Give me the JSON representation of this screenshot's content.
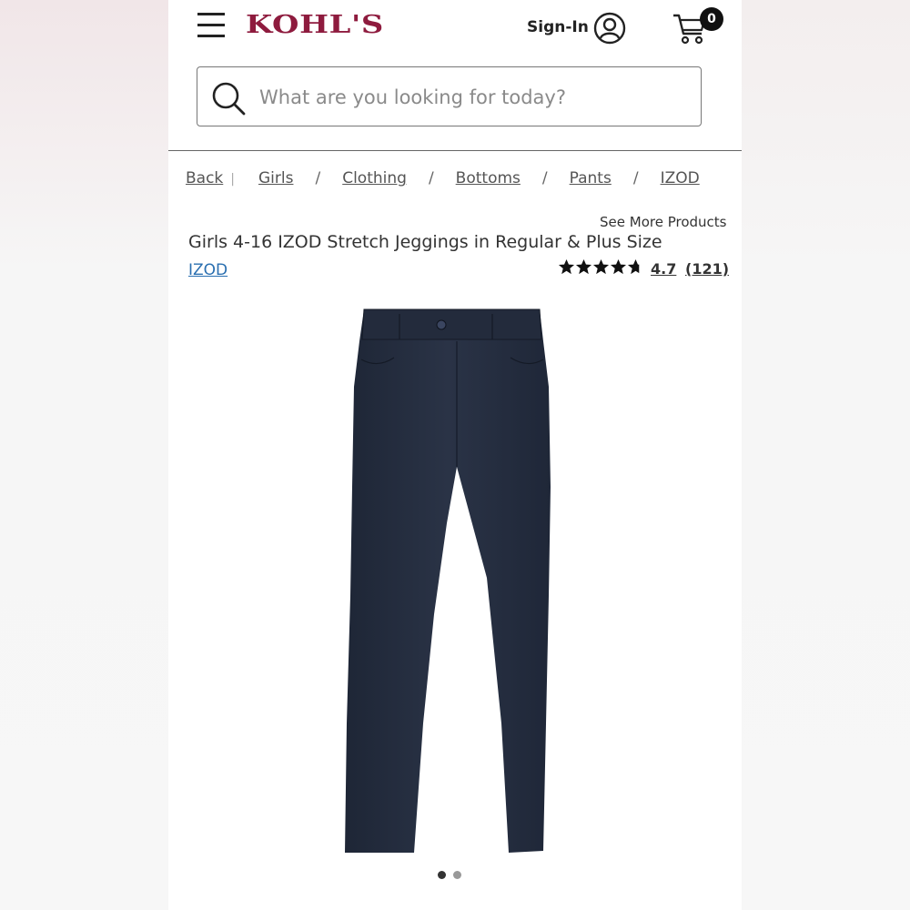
{
  "header": {
    "logo": "KOHL'S",
    "sign_in": "Sign-In",
    "cart_count": "0",
    "brand_color": "#8e1b3e"
  },
  "search": {
    "placeholder": "What are you looking for today?"
  },
  "breadcrumb": {
    "back": "Back",
    "items": [
      "Girls",
      "Clothing",
      "Bottoms",
      "Pants",
      "IZOD"
    ],
    "separator": "/"
  },
  "product": {
    "see_more": "See More Products",
    "title": "Girls 4-16 IZOD Stretch Jeggings in Regular & Plus Size",
    "brand": "IZOD",
    "rating": "4.7",
    "reviews": "(121)",
    "image_icon": "navy-jeggings-image",
    "link_color": "#2a6fb0"
  },
  "carousel": {
    "dots": 2,
    "active": 0
  }
}
